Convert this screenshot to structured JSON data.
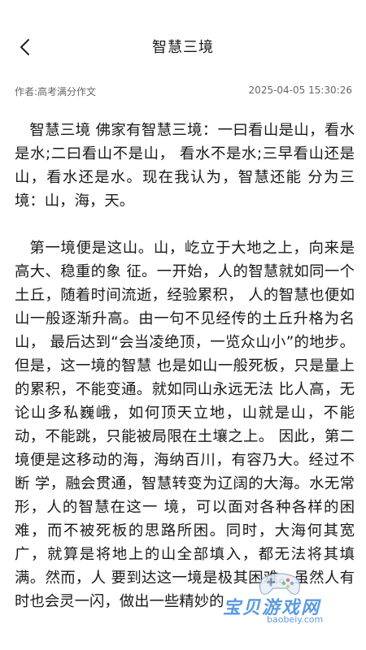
{
  "header": {
    "title": "智慧三境",
    "back_icon": "chevron-left-icon"
  },
  "meta": {
    "author": "作者:高考满分作文",
    "datetime": "2025-04-05 15:30:26"
  },
  "article": {
    "paragraphs": [
      "智慧三境 佛家有智慧三境：一曰看山是山，看水是水;二曰看山不是山， 看水不是水;三早看山还是山，看水还是水。现在我认为，智慧还能 分为三境：山，海，天。",
      "第一境便是这山。山，屹立于大地之上，向来是高大、稳重的象 征。一开始，人的智慧就如同一个土丘，随着时间流逝，经验累积， 人的智慧也便如山一般逐渐升高。由一句不见经传的土丘升格为名山， 最后达到“会当凌绝顶，一览众山小”的地步。但是，这一境的智慧 也是如山一般死板，只是量上的累积，不能变通。就如同山永远无法 比人高，无论山多私巍峨，如何顶天立地，山就是山，不能动，不能跳，只能被局限在土壤之上。 因此，第二境便是这移动的海，海纳百川，有容乃大。经过不断 学，融会贯通，智慧转变为辽阔的大海。水无常形，人的智慧在这一 境，可以面对各种各样的困难，而不被死板的思路所困。同时，大海何其宽广，就算是将地上的山全部填入，都无法将其填满。然而，人 要到达这一境是极其困难。虽然人有时也会灵一闪，做出一些精妙的"
    ]
  },
  "watermark": {
    "text": "宝贝游戏网",
    "url": "baobeiy.com",
    "icon": "gamepad-icon"
  }
}
